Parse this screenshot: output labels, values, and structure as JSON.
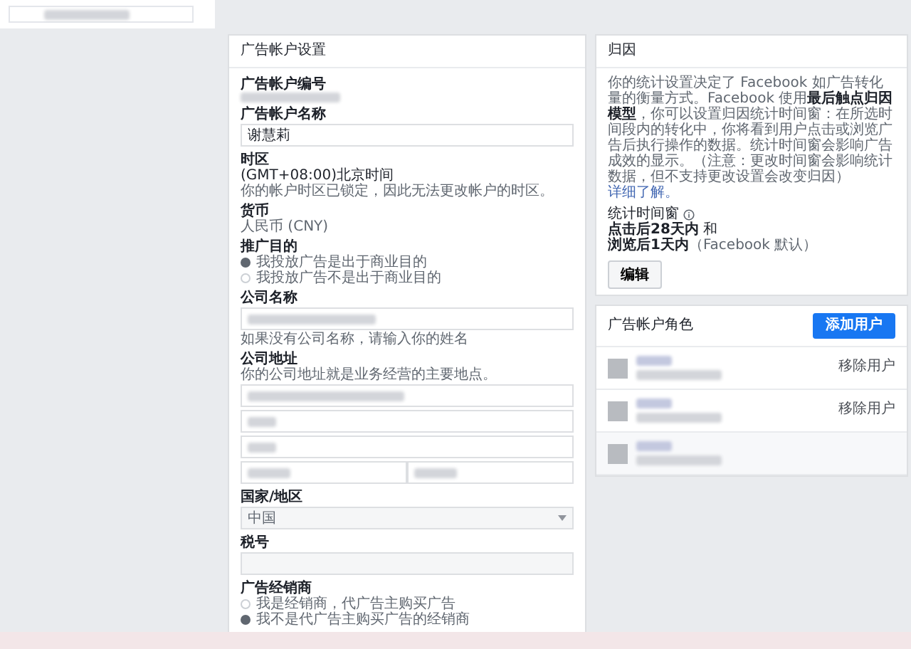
{
  "settings": {
    "title": "广告帐户设置",
    "account_id": {
      "label": "广告帐户编号"
    },
    "account_name": {
      "label": "广告帐户名称",
      "value": "谢慧莉"
    },
    "timezone": {
      "label": "时区",
      "value": "(GMT+08:00)北京时间",
      "hint": "你的帐户时区已锁定，因此无法更改帐户的时区。"
    },
    "currency": {
      "label": "货币",
      "value": "人民币 (CNY)"
    },
    "purpose": {
      "label": "推广目的",
      "options": [
        {
          "label": "我投放广告是出于商业目的",
          "selected": true
        },
        {
          "label": "我投放广告不是出于商业目的",
          "selected": false
        }
      ]
    },
    "company_name": {
      "label": "公司名称",
      "hint": "如果没有公司名称，请输入你的姓名"
    },
    "company_address": {
      "label": "公司地址",
      "hint": "你的公司地址就是业务经营的主要地点。"
    },
    "country": {
      "label": "国家/地区",
      "value": "中国"
    },
    "tax_id": {
      "label": "税号"
    },
    "reseller": {
      "label": "广告经销商",
      "options": [
        {
          "label": "我是经销商，代广告主购买广告",
          "selected": false
        },
        {
          "label": "我不是代广告主购买广告的经销商",
          "selected": true
        }
      ]
    }
  },
  "attribution": {
    "title": "归因",
    "description": "你的统计设置决定了 Facebook 如广告转化量的衡量方式。Facebook 使用**最后触点归因模型**，你可以设置归因统计时间窗：在所选时间段内的转化中，你将看到用户点击或浏览广告后执行操作的数据。统计时间窗会影响广告成效的显示。（注意：更改时间窗会影响统计数据，但不支持更改设置会改变归因）",
    "link": "详细了解。",
    "window_label": "统计时间窗",
    "click_window": "点击后28天内",
    "click_suffix": "和",
    "view_window": "浏览后1天内",
    "view_suffix": "（Facebook 默认）",
    "edit_button": "编辑"
  },
  "roles": {
    "title": "广告帐户角色",
    "add_button": "添加用户",
    "users": [
      {
        "kind": "member",
        "action": "移除用户"
      },
      {
        "kind": "member",
        "action": "移除用户"
      },
      {
        "kind": "self"
      }
    ]
  }
}
